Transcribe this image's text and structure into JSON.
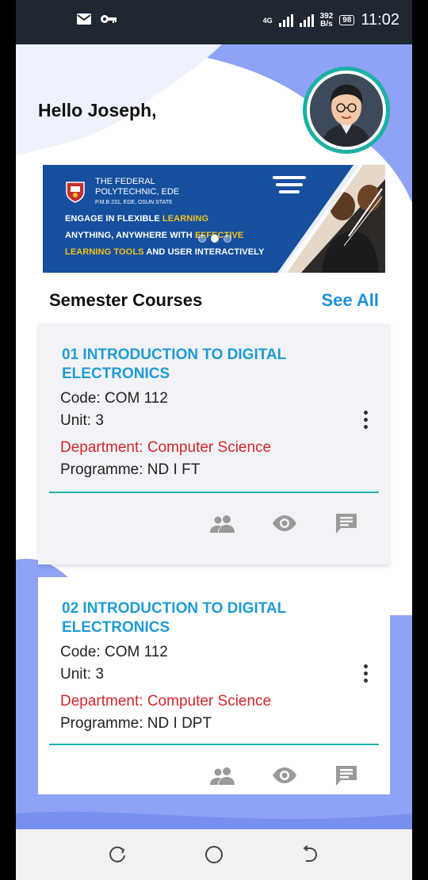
{
  "status_bar": {
    "network_type": "4G",
    "speed_value": "392",
    "speed_unit": "B/s",
    "battery": "98",
    "time": "11:02",
    "icons": [
      "mail-icon",
      "key-icon",
      "signal-icon",
      "signal-icon",
      "battery-icon"
    ]
  },
  "header": {
    "greeting": "Hello Joseph,",
    "search_icon": "search-icon",
    "avatar": "avatar"
  },
  "banner": {
    "school_name_line1": "THE FEDERAL",
    "school_name_line2": "POLYTECHNIC, EDE",
    "school_address": "P.M.B 231, EDE, OSUN STATE",
    "tag_line1_a": "ENGAGE IN FLEXIBLE ",
    "tag_line1_b": "LEARNING",
    "tag_line2_a": "ANYTHING, ANYWHERE WITH ",
    "tag_line2_b": "EFFECTIVE",
    "tag_line3_a": "LEARNING TOOLS",
    "tag_line3_b": " AND USER INTERACTIVELY",
    "active_slide": 1,
    "slide_count": 3
  },
  "section": {
    "title": "Semester Courses",
    "see_all": "See All"
  },
  "courses": [
    {
      "title": "01 INTRODUCTION TO DIGITAL ELECTRONICS",
      "code": "Code: COM 112",
      "unit": "Unit: 3",
      "department": "Department: Computer Science",
      "programme": "Programme: ND I FT"
    },
    {
      "title": "02 INTRODUCTION TO DIGITAL ELECTRONICS",
      "code": "Code: COM 112",
      "unit": "Unit: 3",
      "department": "Department: Computer Science",
      "programme": "Programme: ND I DPT"
    }
  ],
  "colors": {
    "accent": "#1f8fd6",
    "course_title": "#1f9bd6",
    "department": "#d0262b",
    "rule": "#1fb0ac",
    "background_wave": "#8ea3f5",
    "banner": "#154f9e"
  },
  "nav": {
    "buttons": [
      "recent-apps-icon",
      "home-icon",
      "back-icon"
    ]
  }
}
